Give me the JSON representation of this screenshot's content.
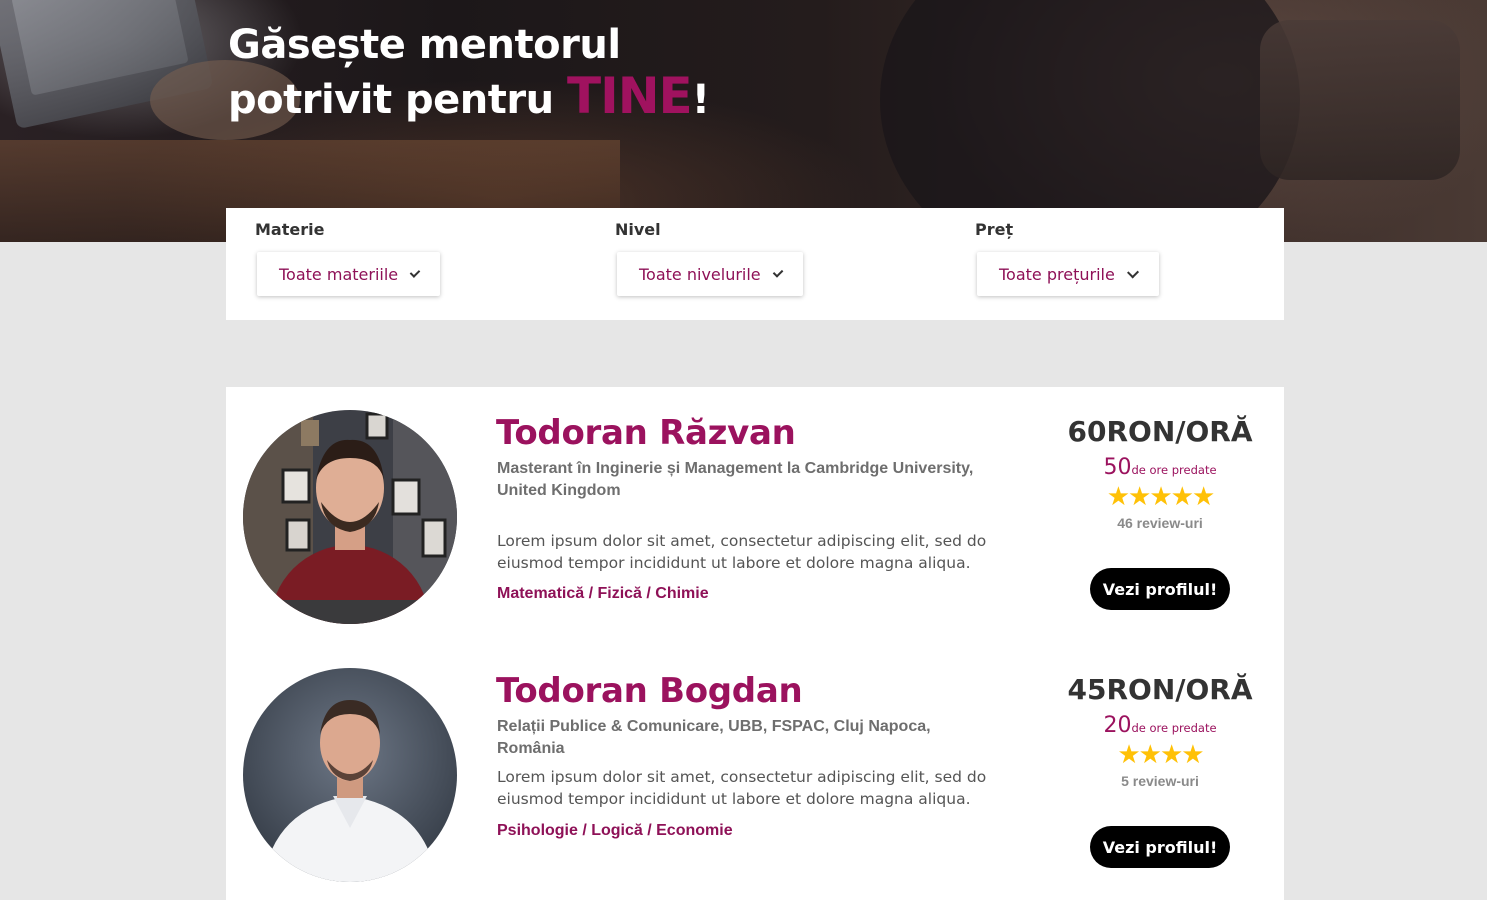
{
  "hero": {
    "title_line1": "Găsește mentorul",
    "title_line2_prefix": "potrivit pentru ",
    "title_highlight": "TINE",
    "title_suffix": "!"
  },
  "filters": [
    {
      "label": "Materie",
      "selected": "Toate materiile"
    },
    {
      "label": "Nivel",
      "selected": "Toate nivelurile"
    },
    {
      "label": "Preț",
      "selected": "Toate prețurile"
    }
  ],
  "mentors": [
    {
      "name": "Todoran Răzvan",
      "subtitle": "Masterant în Inginerie și Management la Cambridge University, United Kingdom",
      "description": "Lorem ipsum dolor sit amet, consectetur adipiscing elit, sed do eiusmod tempor incididunt ut labore et dolore magna aliqua.",
      "subjects": "Matematică / Fizică / Chimie",
      "price": "60RON/ORĂ",
      "hours": "50",
      "hours_label": "de ore predate",
      "rating": 5,
      "stars": "★★★★★",
      "reviews": "46 review-uri",
      "button": "Vezi profilul!"
    },
    {
      "name": "Todoran Bogdan",
      "subtitle": "Relații Publice & Comunicare, UBB, FSPAC, Cluj Napoca, România",
      "description": "Lorem ipsum dolor sit amet, consectetur adipiscing elit, sed do eiusmod tempor incididunt ut labore et dolore magna aliqua.",
      "subjects": "Psihologie / Logică / Economie",
      "price": "45RON/ORĂ",
      "hours": "20",
      "hours_label": "de ore predate",
      "rating": 4,
      "stars": "★★★★",
      "reviews": "5 review-uri",
      "button": "Vezi profilul!"
    }
  ],
  "colors": {
    "accent": "#9b125e",
    "star": "#ffc107",
    "button": "#000000",
    "page_bg": "#e6e6e6"
  }
}
